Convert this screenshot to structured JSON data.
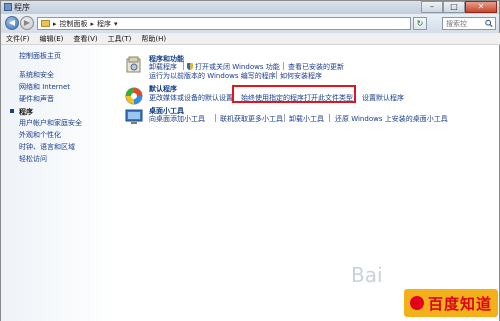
{
  "window": {
    "title": "程序"
  },
  "address": {
    "segments": [
      "控制面板",
      "程序"
    ],
    "search_placeholder": "搜索控"
  },
  "menu": [
    "文件(F)",
    "编辑(E)",
    "查看(V)",
    "工具(T)",
    "帮助(H)"
  ],
  "sidebar": {
    "home": "控制面板主页",
    "items": [
      "系统和安全",
      "网络和 Internet",
      "硬件和声音",
      "程序",
      "用户帐户和家庭安全",
      "外观和个性化",
      "时钟、语言和区域",
      "轻松访问"
    ],
    "current_index": 3
  },
  "sections": {
    "programs": {
      "title": "程序和功能",
      "links": [
        "卸载程序",
        "打开或关闭 Windows 功能",
        "查看已安装的更新",
        "运行为以前版本的 Windows 编写的程序",
        "如何安装程序"
      ]
    },
    "defaults": {
      "title": "默认程序",
      "links": [
        "更改媒体或设备的默认设置",
        "始终使用指定的程序打开此文件类型",
        "设置默认程序"
      ]
    },
    "gadgets": {
      "title": "桌面小工具",
      "links": [
        "向桌面添加小工具",
        "联机获取更多小工具",
        "卸载小工具",
        "还原 Windows 上安装的桌面小工具"
      ]
    }
  },
  "watermark": {
    "text": "百度知道",
    "faint": "Bai"
  },
  "colors": {
    "highlight": "#e3141c",
    "link": "#1a3c8c",
    "heading": "#0b3a83"
  }
}
